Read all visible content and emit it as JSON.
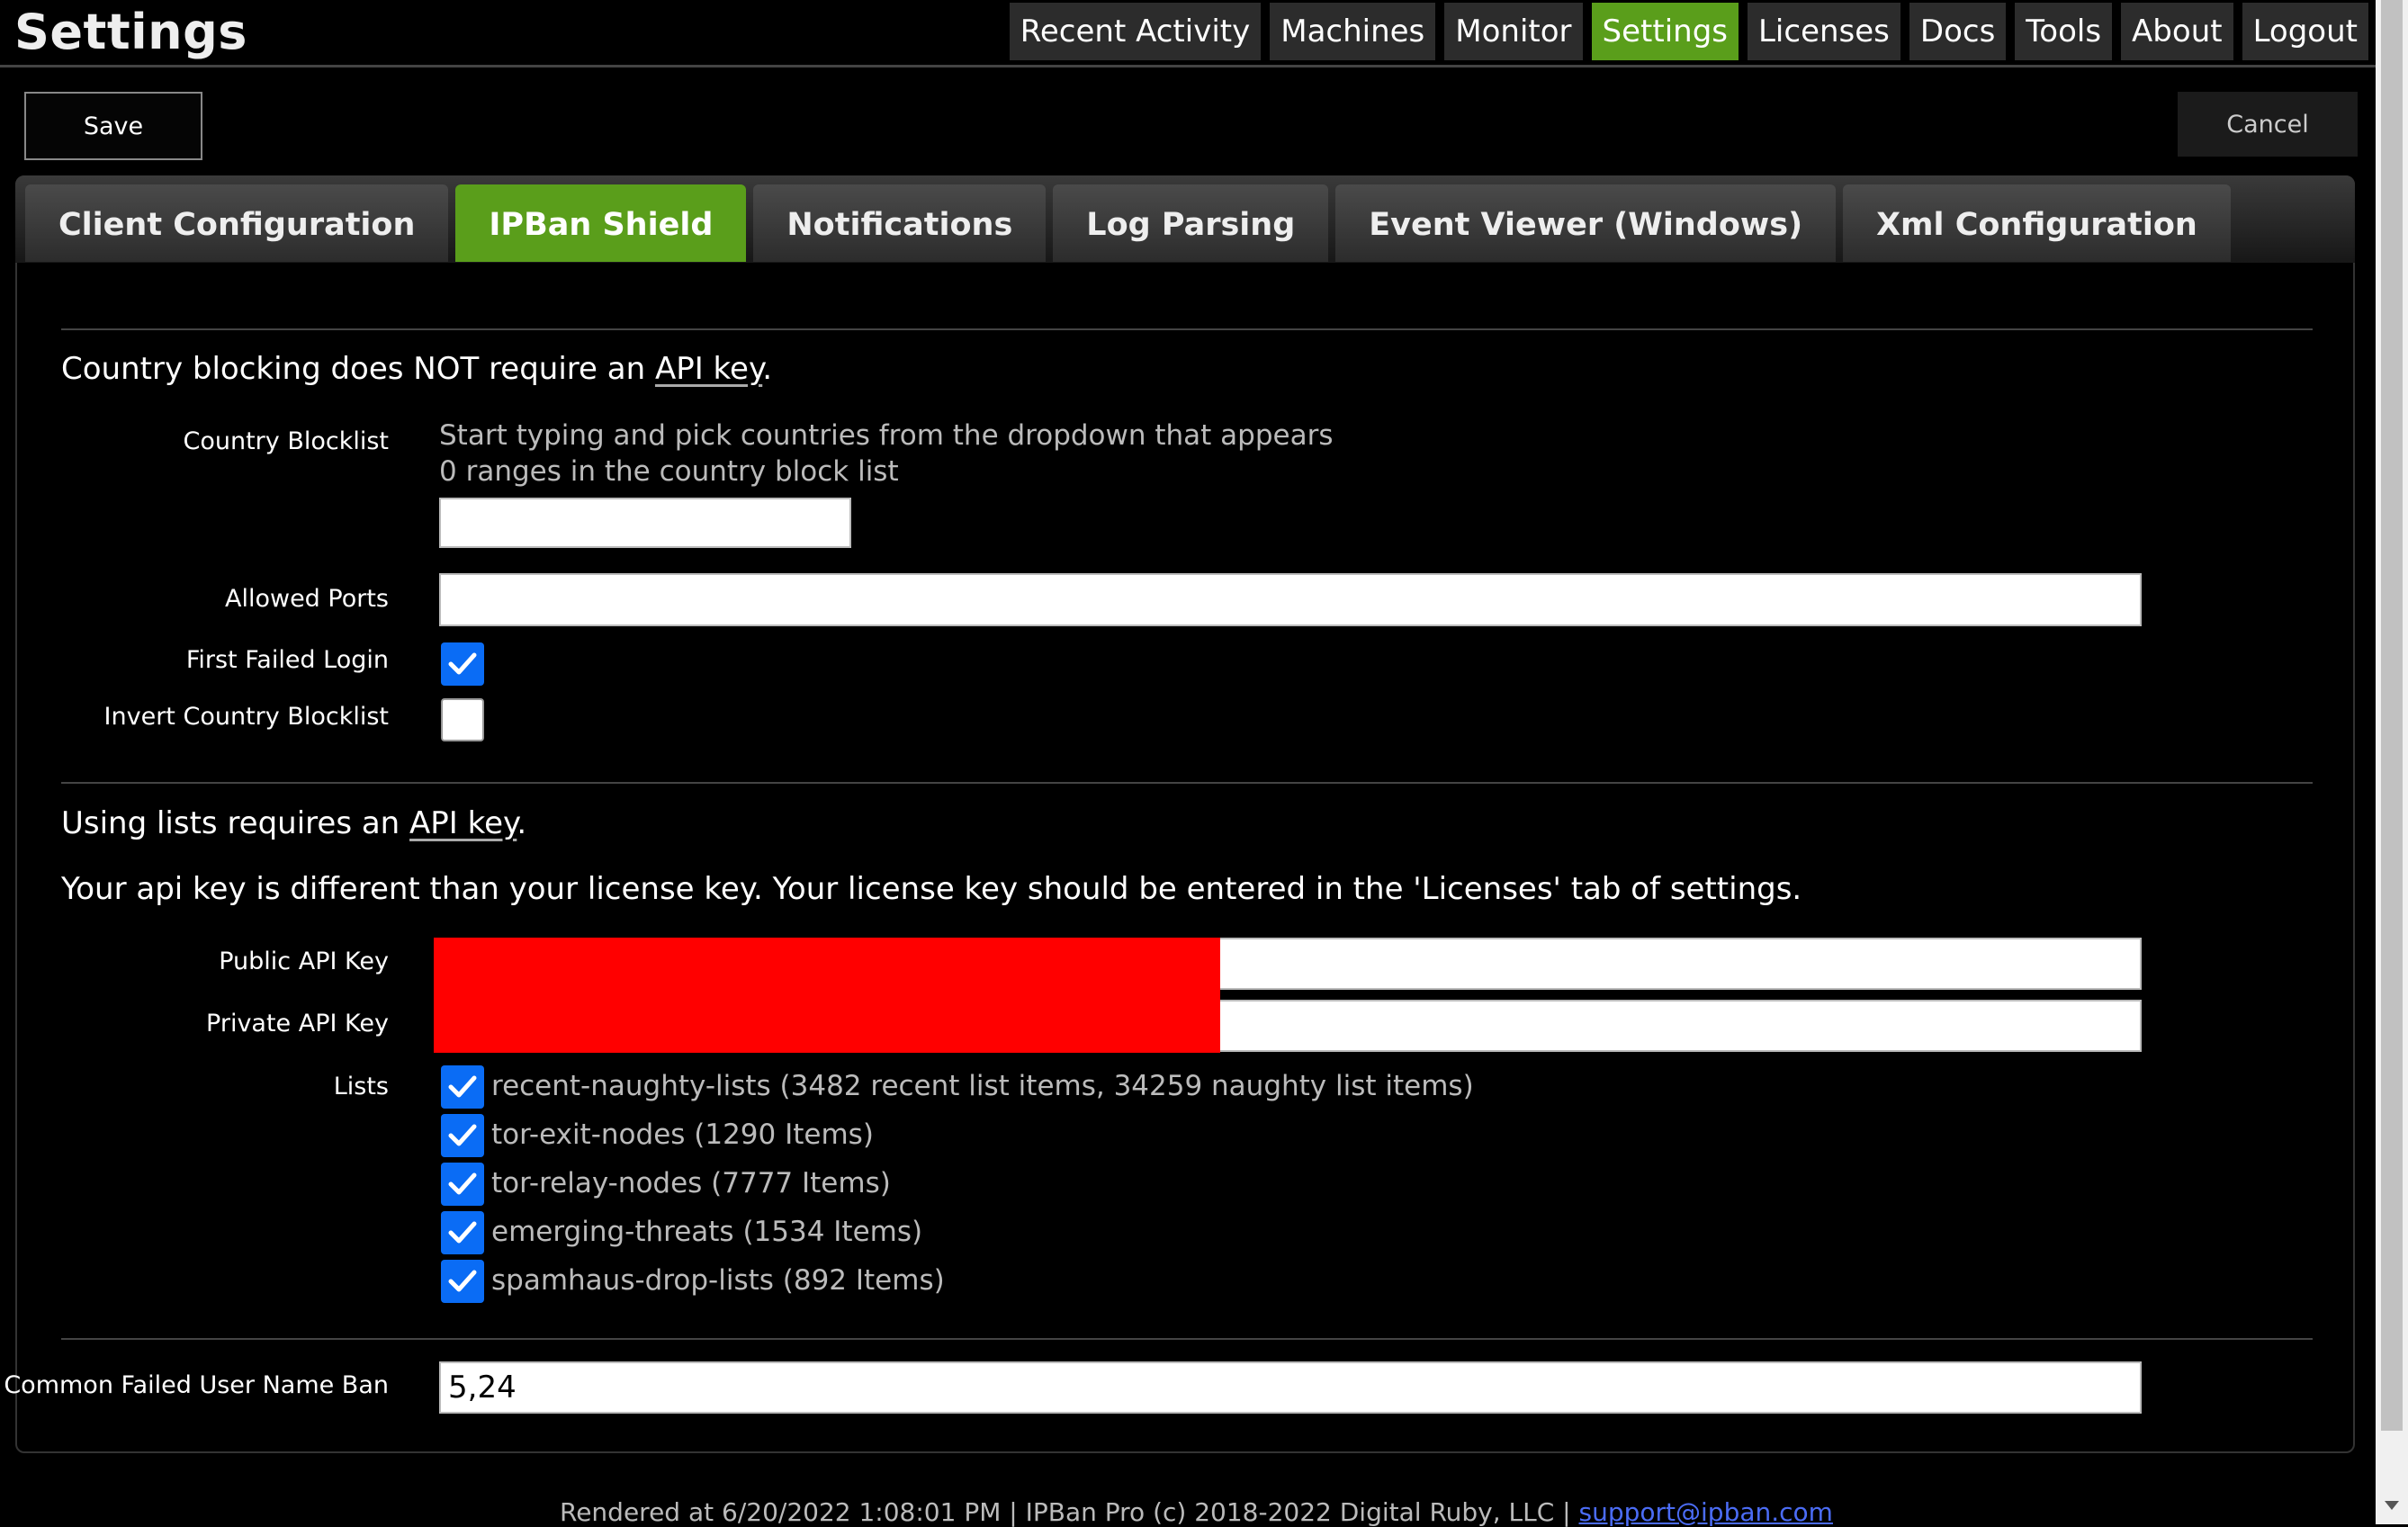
{
  "header": {
    "title": "Settings",
    "nav": [
      "Recent Activity",
      "Machines",
      "Monitor",
      "Settings",
      "Licenses",
      "Docs",
      "Tools",
      "About",
      "Logout"
    ],
    "active_nav": "Settings"
  },
  "toolbar": {
    "save_label": "Save",
    "cancel_label": "Cancel"
  },
  "tabs": {
    "items": [
      "Client Configuration",
      "IPBan Shield",
      "Notifications",
      "Log Parsing",
      "Event Viewer (Windows)",
      "Xml Configuration"
    ],
    "active": "IPBan Shield"
  },
  "country": {
    "note_prefix": "Country blocking does NOT require an ",
    "note_link": "API key",
    "note_suffix": ".",
    "blocklist_label": "Country Blocklist",
    "blocklist_hint": "Start typing and pick countries from the dropdown that appears",
    "blocklist_count": "0 ranges in the country block list",
    "blocklist_value": "",
    "allowed_ports_label": "Allowed Ports",
    "allowed_ports_value": "",
    "first_failed_login_label": "First Failed Login",
    "first_failed_login_checked": true,
    "invert_label": "Invert Country Blocklist",
    "invert_checked": false
  },
  "lists": {
    "note_prefix": "Using lists requires an ",
    "note_link": "API key",
    "note_suffix": ".",
    "apikey_note": "Your api key is different than your license key. Your license key should be entered in the 'Licenses' tab of settings.",
    "public_key_label": "Public API Key",
    "private_key_label": "Private API Key",
    "lists_label": "Lists",
    "items": [
      {
        "label": "recent-naughty-lists (3482 recent list items, 34259 naughty list items)",
        "checked": true
      },
      {
        "label": "tor-exit-nodes (1290 Items)",
        "checked": true
      },
      {
        "label": "tor-relay-nodes (7777 Items)",
        "checked": true
      },
      {
        "label": "emerging-threats (1534 Items)",
        "checked": true
      },
      {
        "label": "spamhaus-drop-lists (892 Items)",
        "checked": true
      }
    ]
  },
  "common_ban": {
    "label": "Common Failed User Name Ban",
    "value": "5,24"
  },
  "footer": {
    "text": "Rendered at 6/20/2022 1:08:01 PM | IPBan Pro (c) 2018-2022 Digital Ruby, LLC | ",
    "email": "support@ipban.com"
  },
  "colors": {
    "accent": "#5a9e1b",
    "checkbox": "#0a6cf5",
    "redaction": "#ff0000"
  }
}
